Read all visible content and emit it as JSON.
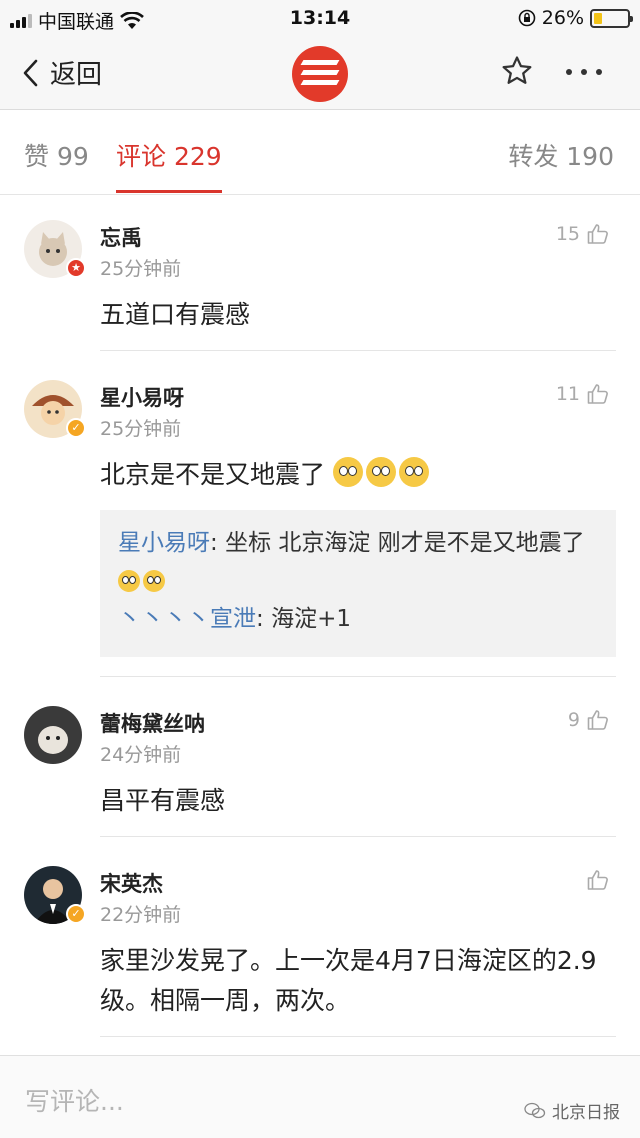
{
  "status_bar": {
    "carrier": "中国联通",
    "time": "13:14",
    "battery_percent": "26%",
    "battery_level": 0.26
  },
  "nav": {
    "back_label": "返回",
    "logo_color": "#e23a2a"
  },
  "tabs": [
    {
      "label": "赞 99",
      "active": false
    },
    {
      "label": "评论 229",
      "active": true
    },
    {
      "label": "转发 190",
      "active": false
    }
  ],
  "accent_color": "#d9352d",
  "comments": [
    {
      "name": "忘禹",
      "time": "25分钟前",
      "likes": "15",
      "text": "五道口有震感",
      "badge": "star-red"
    },
    {
      "name": "星小易呀",
      "time": "25分钟前",
      "likes": "11",
      "text": "北京是不是又地震了",
      "badge": "verified-gold",
      "replies": [
        {
          "name": "星小易呀",
          "sep": ": ",
          "text": "坐标 北京海淀 刚才是不是又地震了"
        },
        {
          "name": "丶丶丶丶宣泄",
          "sep": ": ",
          "text": "海淀+1"
        }
      ]
    },
    {
      "name": "蕾梅黛丝呐",
      "time": "24分钟前",
      "likes": "9",
      "text": "昌平有震感",
      "badge": ""
    },
    {
      "name": "宋英杰",
      "time": "22分钟前",
      "likes": "",
      "text": "家里沙发晃了。上一次是4月7日海淀区的2.9级。相隔一周，两次。",
      "badge": "verified-gold"
    }
  ],
  "bottom": {
    "placeholder": "写评论...",
    "watermark": "北京日报"
  }
}
